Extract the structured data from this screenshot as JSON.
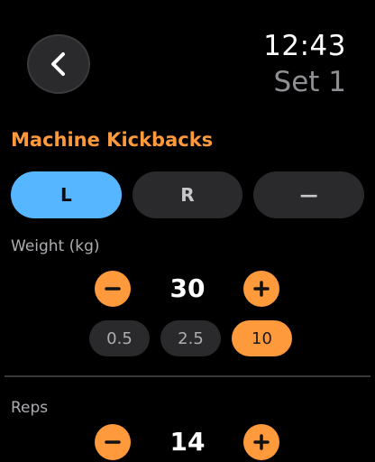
{
  "header": {
    "time": "12:43",
    "set_label": "Set 1"
  },
  "exercise": {
    "title": "Machine Kickbacks"
  },
  "side_selector": {
    "options": [
      {
        "label": "L",
        "selected": true
      },
      {
        "label": "R",
        "selected": false
      },
      {
        "label": "—",
        "selected": false
      }
    ]
  },
  "weight": {
    "label": "Weight (kg)",
    "value": "30",
    "increments": [
      {
        "label": "0.5",
        "selected": false
      },
      {
        "label": "2.5",
        "selected": false
      },
      {
        "label": "10",
        "selected": true
      }
    ]
  },
  "reps": {
    "label": "Reps",
    "value": "14"
  },
  "icons": {
    "back": "chevron-left-icon",
    "decrement": "minus-icon",
    "increment": "plus-icon"
  },
  "colors": {
    "accent": "#ff9a3c",
    "selected_side": "#56b6ff",
    "control_bg": "#2a2a2c",
    "background": "#000000"
  }
}
